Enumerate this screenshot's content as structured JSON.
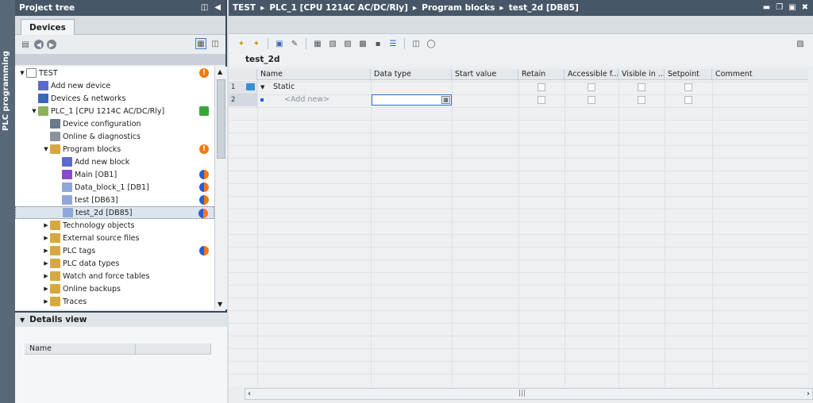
{
  "side_tab": {
    "label": "PLC programming"
  },
  "project_tree": {
    "title": "Project tree",
    "devices_tab": "Devices",
    "items": [
      {
        "label": "TEST",
        "level": 0,
        "arrow": "down",
        "icon": "project-icon",
        "status": "orange"
      },
      {
        "label": "Add new device",
        "level": 1,
        "arrow": "",
        "icon": "add-device-icon",
        "status": ""
      },
      {
        "label": "Devices & networks",
        "level": 1,
        "arrow": "",
        "icon": "network-icon",
        "status": ""
      },
      {
        "label": "PLC_1 [CPU 1214C AC/DC/Rly]",
        "level": 1,
        "arrow": "down",
        "icon": "plc-icon",
        "status": "green"
      },
      {
        "label": "Device configuration",
        "level": 2,
        "arrow": "",
        "icon": "device-config-icon",
        "status": ""
      },
      {
        "label": "Online & diagnostics",
        "level": 2,
        "arrow": "",
        "icon": "diagnostics-icon",
        "status": ""
      },
      {
        "label": "Program blocks",
        "level": 2,
        "arrow": "down",
        "icon": "folder-icon",
        "status": "orange"
      },
      {
        "label": "Add new block",
        "level": 3,
        "arrow": "",
        "icon": "add-block-icon",
        "status": ""
      },
      {
        "label": "Main [OB1]",
        "level": 3,
        "arrow": "",
        "icon": "ob-block-icon",
        "status": "half"
      },
      {
        "label": "Data_block_1 [DB1]",
        "level": 3,
        "arrow": "",
        "icon": "db-block-icon",
        "status": "half"
      },
      {
        "label": "test [DB63]",
        "level": 3,
        "arrow": "",
        "icon": "db-block-icon",
        "status": "half"
      },
      {
        "label": "test_2d [DB85]",
        "level": 3,
        "arrow": "",
        "icon": "db-block-icon",
        "status": "half",
        "selected": true
      },
      {
        "label": "Technology objects",
        "level": 2,
        "arrow": "right",
        "icon": "folder-icon",
        "status": ""
      },
      {
        "label": "External source files",
        "level": 2,
        "arrow": "right",
        "icon": "folder-icon",
        "status": ""
      },
      {
        "label": "PLC tags",
        "level": 2,
        "arrow": "right",
        "icon": "folder-icon",
        "status": "half"
      },
      {
        "label": "PLC data types",
        "level": 2,
        "arrow": "right",
        "icon": "folder-icon",
        "status": ""
      },
      {
        "label": "Watch and force tables",
        "level": 2,
        "arrow": "right",
        "icon": "folder-icon",
        "status": ""
      },
      {
        "label": "Online backups",
        "level": 2,
        "arrow": "right",
        "icon": "folder-icon",
        "status": ""
      },
      {
        "label": "Traces",
        "level": 2,
        "arrow": "right",
        "icon": "folder-icon",
        "status": ""
      }
    ]
  },
  "details_view": {
    "title": "Details view",
    "column_name": "Name"
  },
  "editor": {
    "breadcrumb": [
      "TEST",
      "PLC_1 [CPU 1214C AC/DC/Rly]",
      "Program blocks",
      "test_2d [DB85]"
    ],
    "block_name": "test_2d",
    "columns": [
      "Name",
      "Data type",
      "Start value",
      "Retain",
      "Accessible f...",
      "Visible in ...",
      "Setpoint",
      "Comment"
    ],
    "rows": [
      {
        "num": "1",
        "name": "Static"
      },
      {
        "num": "2",
        "name": "<Add new>"
      }
    ]
  },
  "colors": {
    "titlebar": "#475768",
    "status_orange": "#f07a10",
    "status_blue": "#2a5bd8",
    "status_green": "#3aa63a"
  }
}
